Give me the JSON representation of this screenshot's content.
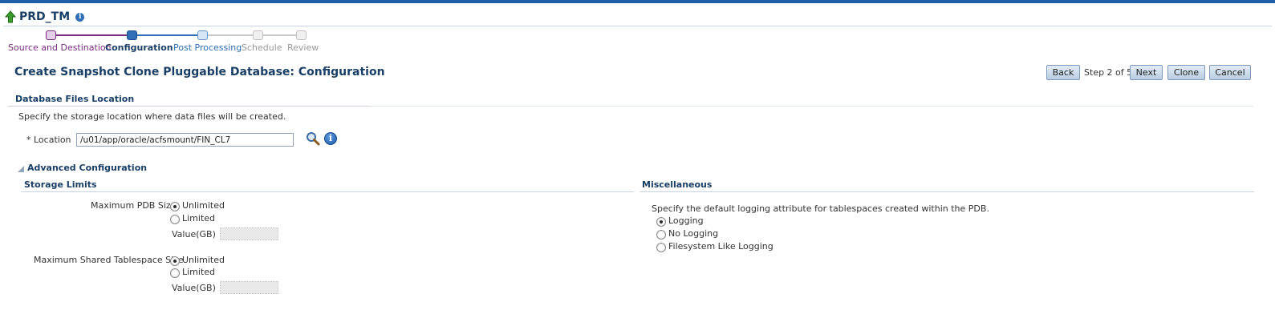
{
  "header": {
    "target_name": "PRD_TM"
  },
  "train": {
    "steps": [
      {
        "label": "Source and Destination",
        "state": "visited"
      },
      {
        "label": "Configuration",
        "state": "current"
      },
      {
        "label": "Post Processing",
        "state": "next"
      },
      {
        "label": "Schedule",
        "state": "disabled"
      },
      {
        "label": "Review",
        "state": "disabled"
      }
    ]
  },
  "page": {
    "title": "Create Snapshot Clone Pluggable Database: Configuration",
    "step_indicator": "Step 2 of 5"
  },
  "buttons": {
    "back": "Back",
    "next": "Next",
    "clone": "Clone",
    "cancel": "Cancel"
  },
  "db_files": {
    "heading": "Database Files Location",
    "instruction": "Specify the storage location where data files will be created.",
    "location_label": "* Location",
    "location_value": "/u01/app/oracle/acfsmount/FIN_CL7"
  },
  "advanced": {
    "heading": "Advanced Configuration",
    "storage_limits": {
      "heading": "Storage Limits",
      "max_pdb": {
        "label": "Maximum PDB Size",
        "option_unlimited": "Unlimited",
        "option_limited": "Limited",
        "selected": "Unlimited",
        "value_label": "Value(GB)"
      },
      "max_shared": {
        "label": "Maximum Shared Tablespace Size",
        "option_unlimited": "Unlimited",
        "option_limited": "Limited",
        "selected": "Unlimited",
        "value_label": "Value(GB)"
      }
    },
    "misc": {
      "heading": "Miscellaneous",
      "instruction": "Specify the default logging attribute for tablespaces created within the PDB.",
      "options": [
        "Logging",
        "No Logging",
        "Filesystem Like Logging"
      ],
      "selected": "Logging"
    }
  },
  "colors": {
    "brand_bar": "#1f5ea8",
    "heading_text": "#1a3f66",
    "train_visited": "#7b2d82",
    "train_current": "#2f6fb7"
  },
  "icons": [
    "up-arrow-icon",
    "info-icon",
    "search-icon",
    "collapse-triangle-icon"
  ]
}
